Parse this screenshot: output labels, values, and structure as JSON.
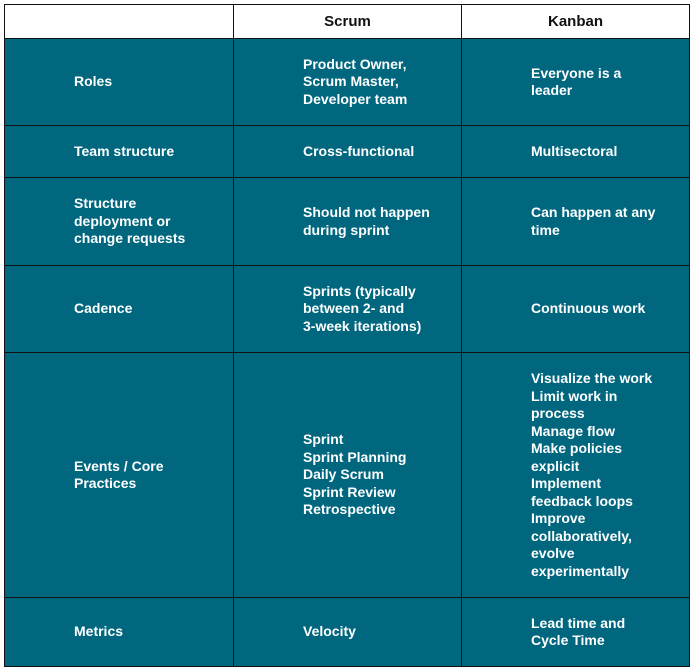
{
  "table": {
    "headers": [
      "",
      "Scrum",
      "Kanban"
    ],
    "rows": [
      {
        "label": "Roles",
        "scrum": "Product Owner,\nScrum Master,\nDeveloper team",
        "kanban": "Everyone is a\nleader"
      },
      {
        "label": "Team structure",
        "scrum": "Cross-functional",
        "kanban": "Multisectoral"
      },
      {
        "label": "Structure\ndeployment or\nchange requests",
        "scrum": "Should not happen\nduring sprint",
        "kanban": "Can happen at any\ntime"
      },
      {
        "label": "Cadence",
        "scrum": "Sprints (typically\nbetween 2- and\n3-week iterations)",
        "kanban": "Continuous work"
      },
      {
        "label": "Events / Core\nPractices",
        "scrum": "Sprint\nSprint Planning\nDaily Scrum\nSprint Review\nRetrospective",
        "kanban": "Visualize the work\nLimit work in\nprocess\nManage flow\nMake policies\nexplicit\nImplement\nfeedback loops\nImprove\ncollaboratively,\nevolve\nexperimentally"
      },
      {
        "label": "Metrics",
        "scrum": "Velocity",
        "kanban": "Lead time and\nCycle Time"
      }
    ]
  },
  "colors": {
    "cell_background": "#00677f",
    "cell_text": "#ffffff",
    "header_background": "#ffffff",
    "header_text": "#111111",
    "border": "#111111"
  }
}
